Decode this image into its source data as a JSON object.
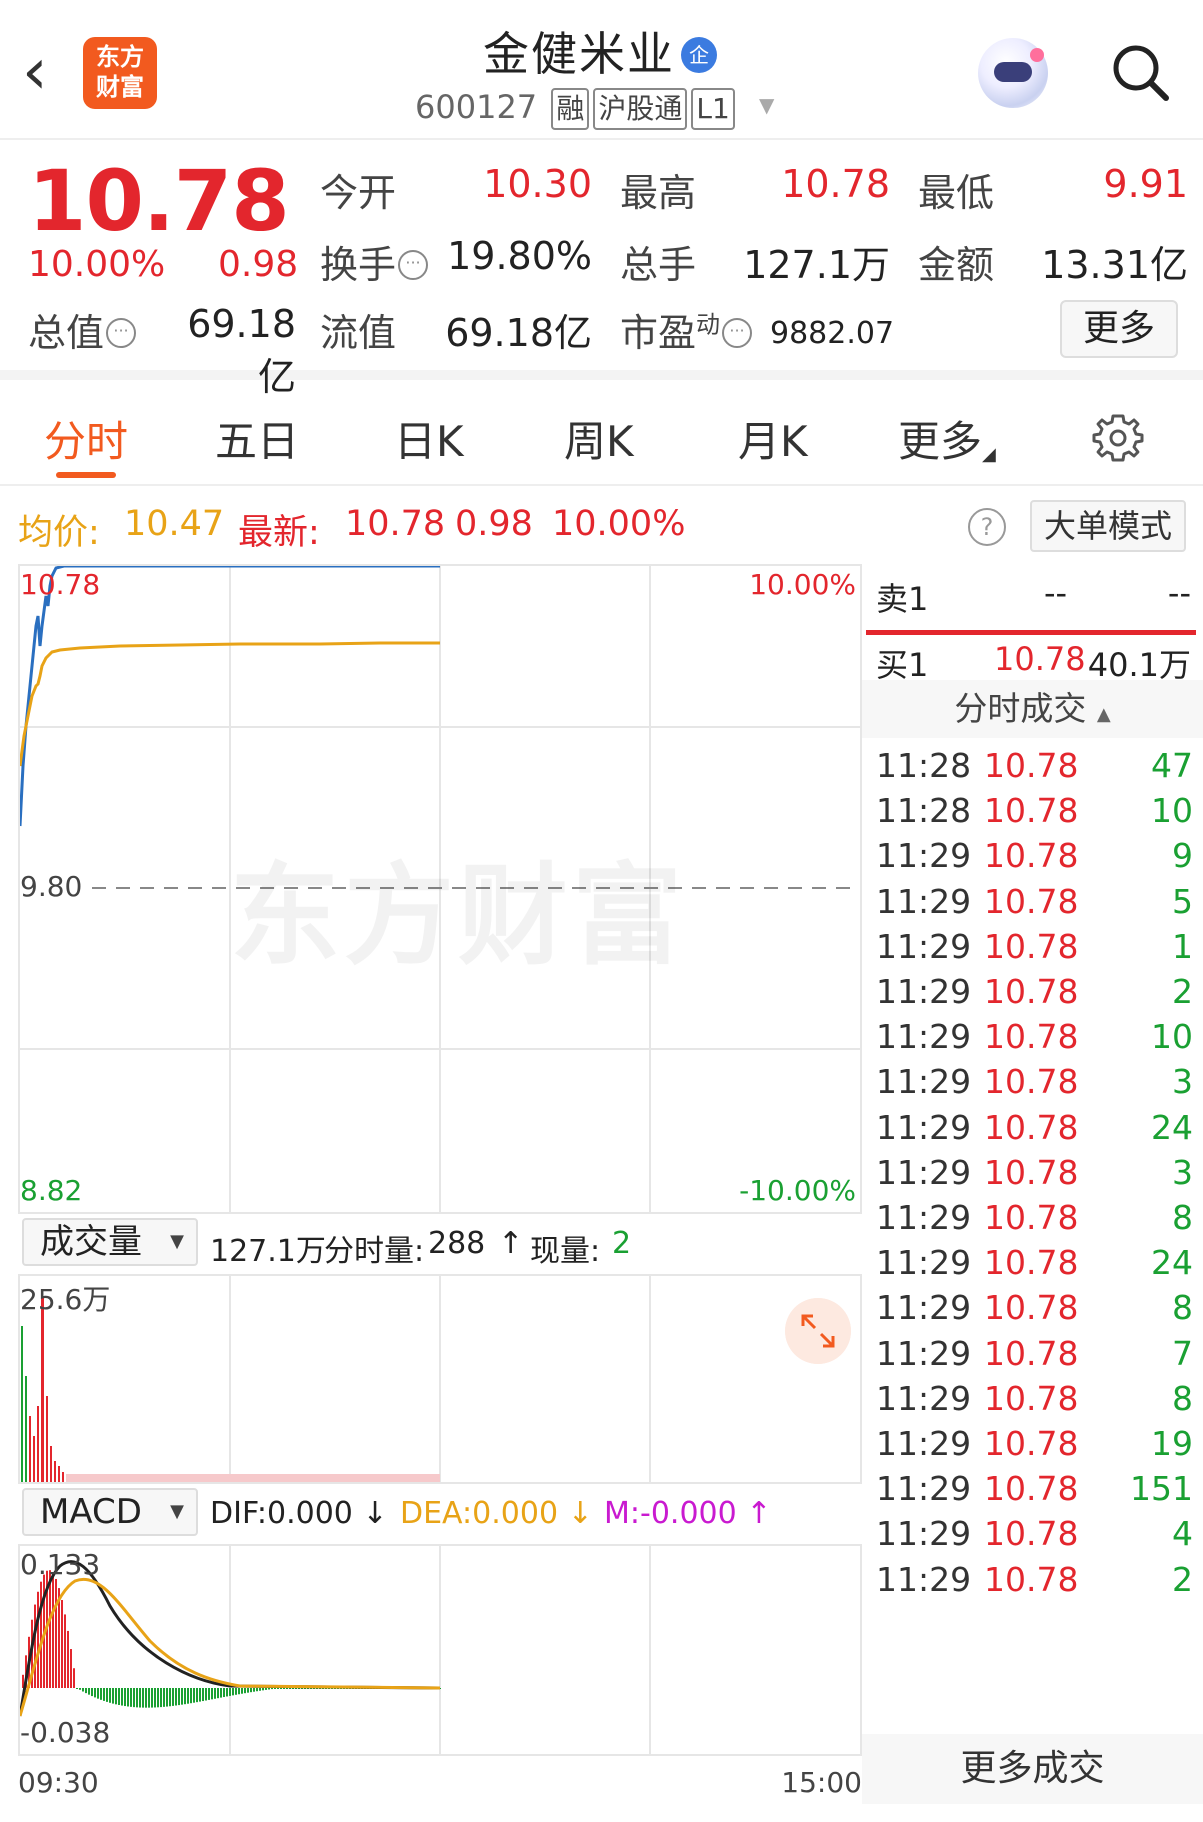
{
  "header": {
    "logo_line1": "东方",
    "logo_line2": "财富",
    "title": "金健米业",
    "badge": "企",
    "code": "600127",
    "tags": [
      "融",
      "沪股通",
      "L1"
    ]
  },
  "quote": {
    "price": "10.78",
    "pct": "10.00%",
    "change": "0.98",
    "open_label": "今开",
    "open_value": "10.30",
    "high_label": "最高",
    "high_value": "10.78",
    "low_label": "最低",
    "low_value": "9.91",
    "turnover_label": "换手",
    "turnover_value": "19.80%",
    "volume_label": "总手",
    "volume_value": "127.1万",
    "amount_label": "金额",
    "amount_value": "13.31亿",
    "mktcap_label": "总值",
    "mktcap_value": "69.18亿",
    "float_label": "流值",
    "float_value": "69.18亿",
    "pe_label": "市盈",
    "pe_sup": "动",
    "pe_value": "9882.07",
    "more_label": "更多"
  },
  "tabs": [
    "分时",
    "五日",
    "日K",
    "周K",
    "月K",
    "更多"
  ],
  "price_row": {
    "avg_label": "均价:",
    "avg_value": "10.47",
    "latest_label": "最新:",
    "latest_value": "10.78",
    "latest_change": "0.98",
    "latest_pct": "10.00%",
    "help": "?",
    "big_order": "大单模式"
  },
  "chart": {
    "y_top": "10.78",
    "y_mid": "9.80",
    "y_bot": "8.82",
    "pct_top": "10.00%",
    "pct_bot": "-10.00%",
    "watermark": "东方财富"
  },
  "volume": {
    "selector": "成交量",
    "total": "127.1万",
    "minute_label": "分时量:",
    "minute_value": "288",
    "arrow": "↑",
    "current_label": "现量:",
    "current_value": "2",
    "y_top": "25.6万"
  },
  "macd": {
    "selector": "MACD",
    "dif": "DIF:0.000 ↓",
    "dea": "DEA:0.000 ↓",
    "m": "M:-0.000 ↑",
    "y_top": "0.133",
    "y_bot": "-0.038"
  },
  "time_axis": {
    "start": "09:30",
    "end": "15:00"
  },
  "orderbook": {
    "sell_label": "卖1",
    "sell_price": "--",
    "sell_vol": "--",
    "buy_label": "买1",
    "buy_price": "10.78",
    "buy_vol": "40.1万"
  },
  "trades_header": "分时成交",
  "trades": [
    {
      "time": "11:28",
      "price": "10.78",
      "vol": "47"
    },
    {
      "time": "11:28",
      "price": "10.78",
      "vol": "10"
    },
    {
      "time": "11:29",
      "price": "10.78",
      "vol": "9"
    },
    {
      "time": "11:29",
      "price": "10.78",
      "vol": "5"
    },
    {
      "time": "11:29",
      "price": "10.78",
      "vol": "1"
    },
    {
      "time": "11:29",
      "price": "10.78",
      "vol": "2"
    },
    {
      "time": "11:29",
      "price": "10.78",
      "vol": "10"
    },
    {
      "time": "11:29",
      "price": "10.78",
      "vol": "3"
    },
    {
      "time": "11:29",
      "price": "10.78",
      "vol": "24"
    },
    {
      "time": "11:29",
      "price": "10.78",
      "vol": "3"
    },
    {
      "time": "11:29",
      "price": "10.78",
      "vol": "8"
    },
    {
      "time": "11:29",
      "price": "10.78",
      "vol": "24"
    },
    {
      "time": "11:29",
      "price": "10.78",
      "vol": "8"
    },
    {
      "time": "11:29",
      "price": "10.78",
      "vol": "7"
    },
    {
      "time": "11:29",
      "price": "10.78",
      "vol": "8"
    },
    {
      "time": "11:29",
      "price": "10.78",
      "vol": "19"
    },
    {
      "time": "11:29",
      "price": "10.78",
      "vol": "151"
    },
    {
      "time": "11:29",
      "price": "10.78",
      "vol": "4"
    },
    {
      "time": "11:29",
      "price": "10.78",
      "vol": "2"
    }
  ],
  "more_trades": "更多成交",
  "colors": {
    "up": "#e3262d",
    "down": "#1aa032",
    "avg": "#e8a317",
    "price_line": "#2a6fc0",
    "accent": "#f25a1f"
  }
}
